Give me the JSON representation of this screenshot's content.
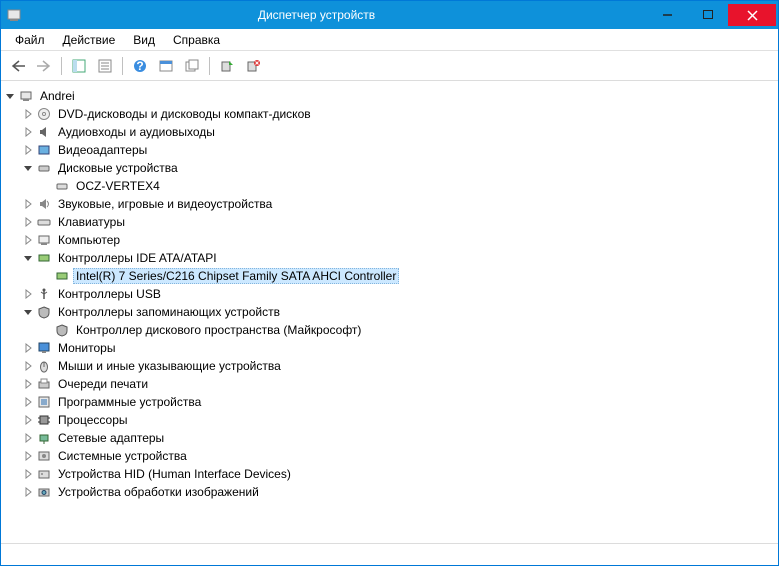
{
  "window": {
    "title": "Диспетчер устройств"
  },
  "menu": {
    "file": "Файл",
    "action": "Действие",
    "view": "Вид",
    "help": "Справка"
  },
  "toolbar_icons": {
    "back": "←",
    "forward": "→"
  },
  "tree": {
    "root": "Andrei",
    "items": [
      {
        "icon": "dvd",
        "label": "DVD-дисководы и дисководы компакт-дисков",
        "expanded": false,
        "children": []
      },
      {
        "icon": "audio",
        "label": "Аудиовходы и аудиовыходы",
        "expanded": false,
        "children": []
      },
      {
        "icon": "video",
        "label": "Видеоадаптеры",
        "expanded": false,
        "children": []
      },
      {
        "icon": "disk",
        "label": "Дисковые устройства",
        "expanded": true,
        "children": [
          {
            "icon": "disk-drive",
            "label": "OCZ-VERTEX4"
          }
        ]
      },
      {
        "icon": "sound",
        "label": "Звуковые, игровые и видеоустройства",
        "expanded": false,
        "children": []
      },
      {
        "icon": "keyboard",
        "label": "Клавиатуры",
        "expanded": false,
        "children": []
      },
      {
        "icon": "computer",
        "label": "Компьютер",
        "expanded": false,
        "children": []
      },
      {
        "icon": "ide",
        "label": "Контроллеры IDE ATA/ATAPI",
        "expanded": true,
        "children": [
          {
            "icon": "ide-item",
            "label": "Intel(R) 7 Series/C216 Chipset Family SATA AHCI Controller",
            "selected": true
          }
        ]
      },
      {
        "icon": "usb",
        "label": "Контроллеры USB",
        "expanded": false,
        "children": []
      },
      {
        "icon": "storage-ctl",
        "label": "Контроллеры запоминающих устройств",
        "expanded": true,
        "children": [
          {
            "icon": "storage-ctl",
            "label": "Контроллер дискового пространства (Майкрософт)"
          }
        ]
      },
      {
        "icon": "monitor",
        "label": "Мониторы",
        "expanded": false,
        "children": []
      },
      {
        "icon": "mouse",
        "label": "Мыши и иные указывающие устройства",
        "expanded": false,
        "children": []
      },
      {
        "icon": "print-queue",
        "label": "Очереди печати",
        "expanded": false,
        "children": []
      },
      {
        "icon": "software",
        "label": "Программные устройства",
        "expanded": false,
        "children": []
      },
      {
        "icon": "cpu",
        "label": "Процессоры",
        "expanded": false,
        "children": []
      },
      {
        "icon": "network",
        "label": "Сетевые адаптеры",
        "expanded": false,
        "children": []
      },
      {
        "icon": "system",
        "label": "Системные устройства",
        "expanded": false,
        "children": []
      },
      {
        "icon": "hid",
        "label": "Устройства HID (Human Interface Devices)",
        "expanded": false,
        "children": []
      },
      {
        "icon": "imaging",
        "label": "Устройства обработки изображений",
        "expanded": false,
        "children": []
      }
    ]
  }
}
